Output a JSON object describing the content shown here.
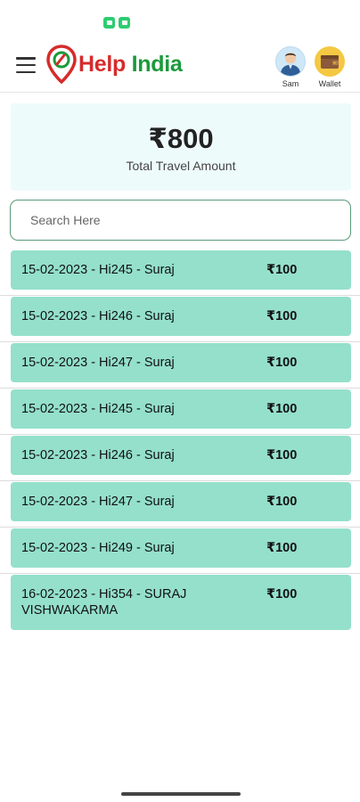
{
  "app": {
    "brand_help": "Help",
    "brand_india": "India"
  },
  "header": {
    "user_label": "Sam",
    "wallet_label": "Wallet"
  },
  "summary": {
    "amount": "₹800",
    "label": "Total Travel Amount"
  },
  "search": {
    "placeholder": "Search Here",
    "value": ""
  },
  "trips": [
    {
      "title": "15-02-2023 - Hi245 - Suraj",
      "amount": "₹100"
    },
    {
      "title": "15-02-2023 - Hi246 - Suraj",
      "amount": "₹100"
    },
    {
      "title": "15-02-2023 - Hi247 - Suraj",
      "amount": "₹100"
    },
    {
      "title": "15-02-2023 - Hi245 - Suraj",
      "amount": "₹100"
    },
    {
      "title": "15-02-2023 - Hi246 - Suraj",
      "amount": "₹100"
    },
    {
      "title": "15-02-2023 - Hi247 - Suraj",
      "amount": "₹100"
    },
    {
      "title": "15-02-2023 - Hi249 - Suraj",
      "amount": "₹100"
    },
    {
      "title": "16-02-2023 - Hi354 - SURAJ VISHWAKARMA",
      "amount": "₹100"
    }
  ],
  "colors": {
    "brand_red": "#d62b2b",
    "brand_green": "#1a9a3a",
    "item_bg": "#94e0cb",
    "summary_bg": "#eefbfb"
  }
}
